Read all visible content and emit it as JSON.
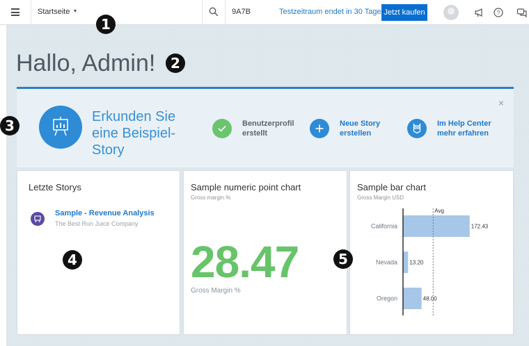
{
  "topbar": {
    "home_label": "Startseite",
    "tenant": "9A7B",
    "trial_text": "Testzeitraum endet in 30 Tagen.",
    "buy_label": "Jetzt kaufen"
  },
  "annotations": [
    "1",
    "2",
    "3",
    "4",
    "5"
  ],
  "greeting": "Hallo, Admin!",
  "banner": {
    "explore_text": "Erkunden Sie eine Beispiel-Story",
    "close": "×",
    "steps": [
      {
        "label": "Benutzerprofil erstellt",
        "color": "#6cc46f",
        "label_color": "#5a6670",
        "icon": "check-icon"
      },
      {
        "label": "Neue Story erstellen",
        "color": "#2e8bd5",
        "label_color": "#2179c8",
        "icon": "plus-icon"
      },
      {
        "label": "Im Help Center mehr erfahren",
        "color": "#2e8bd5",
        "label_color": "#2179c8",
        "icon": "owl-icon"
      }
    ]
  },
  "recent": {
    "title": "Letzte Storys",
    "item_title": "Sample - Revenue Analysis",
    "item_sub": "The Best Run Juice Company"
  },
  "numeric": {
    "title": "Sample numeric point chart",
    "subtitle": "Gross margin %",
    "value": "28.47",
    "label": "Gross Margin %"
  },
  "barchart": {
    "title": "Sample bar chart",
    "subtitle": "Gross Margin USD"
  },
  "chart_data": {
    "type": "bar",
    "orientation": "horizontal",
    "title": "Sample bar chart",
    "subtitle": "Gross Margin USD",
    "categories": [
      "California",
      "Nevada",
      "Oregon"
    ],
    "values": [
      172.43,
      13.2,
      48.0
    ],
    "value_labels": [
      "172.43",
      "13.20",
      "48.00"
    ],
    "reference_line": {
      "label": "Avg",
      "value": 77.88
    },
    "xlim": [
      0,
      180
    ],
    "bar_color": "#a6c7e8"
  }
}
